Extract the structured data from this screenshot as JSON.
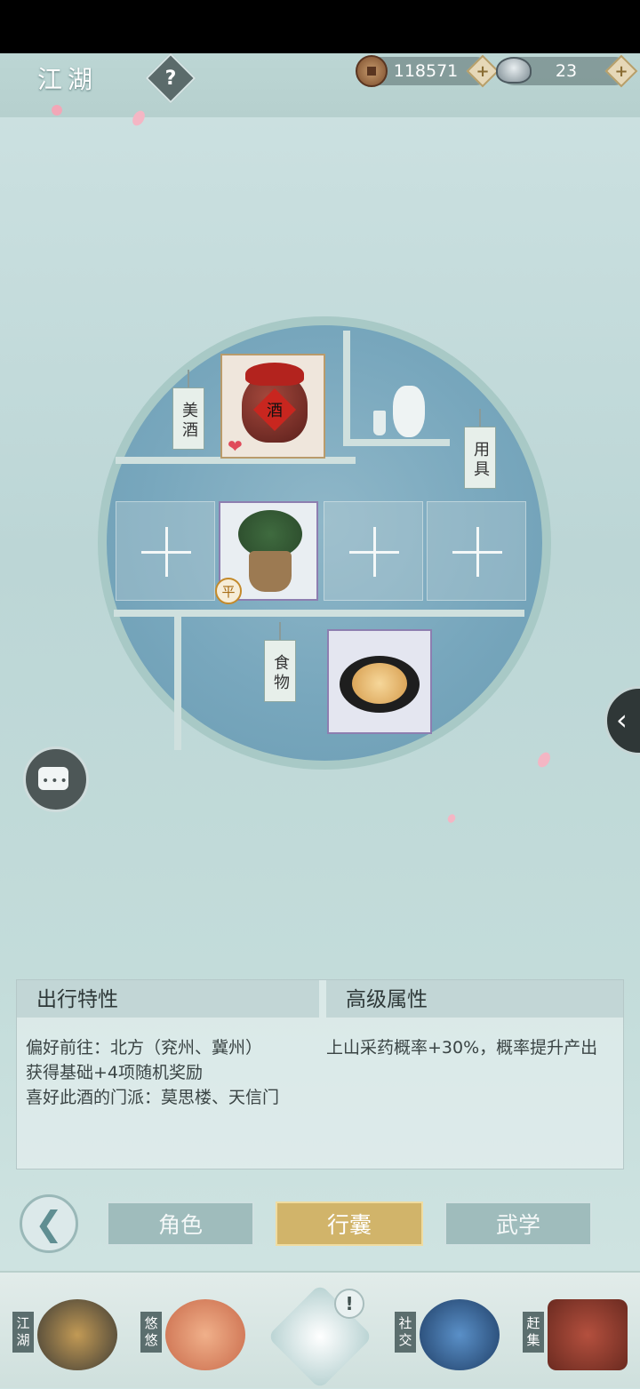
{
  "header": {
    "title": "江湖",
    "help_symbol": "?",
    "currency": [
      {
        "icon": "copper-coin-icon",
        "value": "118571",
        "add_symbol": "+"
      },
      {
        "icon": "silver-ingot-icon",
        "value": "23",
        "add_symbol": "+"
      }
    ]
  },
  "bag": {
    "wine_label": "美酒",
    "wine_item": {
      "jar_text": "酒",
      "icon": "wine-jar-icon"
    },
    "tools_label": "用具",
    "food_label": "食物",
    "herb_item": {
      "icon": "herb-basket-icon",
      "badge": "平"
    },
    "food_item": {
      "icon": "noodle-plate-icon"
    },
    "empty_slot_symbol": "+"
  },
  "info": {
    "left_header": "出行特性",
    "right_header": "高级属性",
    "left_lines": [
      "偏好前往：北方（兖州、冀州）",
      "获得基础+4项随机奖励",
      "喜好此酒的门派：莫思楼、天信门"
    ],
    "right_lines": [
      "上山采药概率+30%，概率提升产出"
    ]
  },
  "tabs": [
    {
      "label": "角色",
      "active": false
    },
    {
      "label": "行囊",
      "active": true
    },
    {
      "label": "武学",
      "active": false
    }
  ],
  "nav": [
    {
      "label": "江湖",
      "icon": "jianghu-hat-icon"
    },
    {
      "label": "悠悠",
      "icon": "swallow-bird-icon"
    },
    {
      "label": "",
      "icon": "center-star-icon",
      "badge": "!"
    },
    {
      "label": "社交",
      "icon": "wave-bowl-icon"
    },
    {
      "label": "赶集",
      "icon": "market-basket-icon"
    }
  ],
  "colors": {
    "accent_gold": "#d1b46a",
    "tab_inactive": "#9fbcbc",
    "background": "#c3dcda"
  }
}
